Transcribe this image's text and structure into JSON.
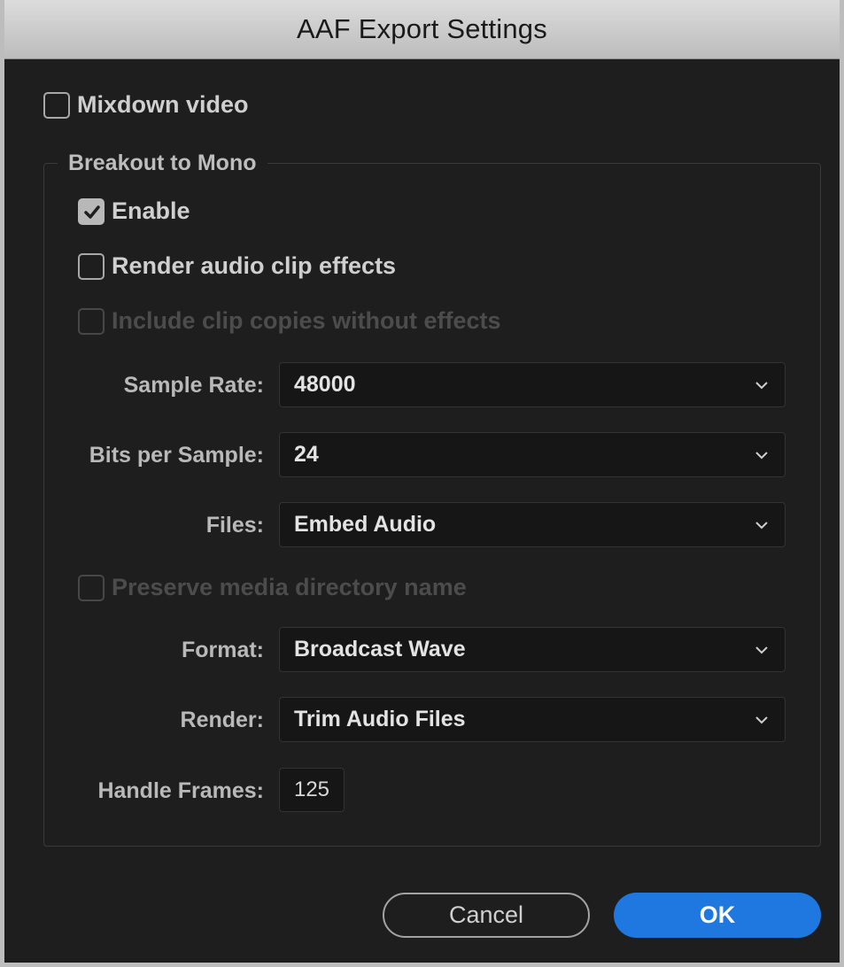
{
  "window": {
    "title": "AAF Export Settings"
  },
  "mixdown_video": {
    "label": "Mixdown video",
    "checked": false
  },
  "breakout": {
    "legend": "Breakout to Mono",
    "enable": {
      "label": "Enable",
      "checked": true
    },
    "render_effects": {
      "label": "Render audio clip effects",
      "checked": false
    },
    "include_copies": {
      "label": "Include clip copies without effects",
      "checked": false,
      "enabled": false
    },
    "sample_rate": {
      "label": "Sample Rate:",
      "value": "48000"
    },
    "bits_per_sample": {
      "label": "Bits per Sample:",
      "value": "24"
    },
    "files": {
      "label": "Files:",
      "value": "Embed Audio"
    },
    "preserve_dir": {
      "label": "Preserve media directory name",
      "checked": false,
      "enabled": false
    },
    "format": {
      "label": "Format:",
      "value": "Broadcast Wave"
    },
    "render": {
      "label": "Render:",
      "value": "Trim Audio Files"
    },
    "handle_frames": {
      "label": "Handle Frames:",
      "value": "125"
    }
  },
  "buttons": {
    "cancel": "Cancel",
    "ok": "OK"
  },
  "colors": {
    "accent": "#1f78e0",
    "background": "#1e1e1e",
    "titlebar": "#cfcfcf"
  }
}
